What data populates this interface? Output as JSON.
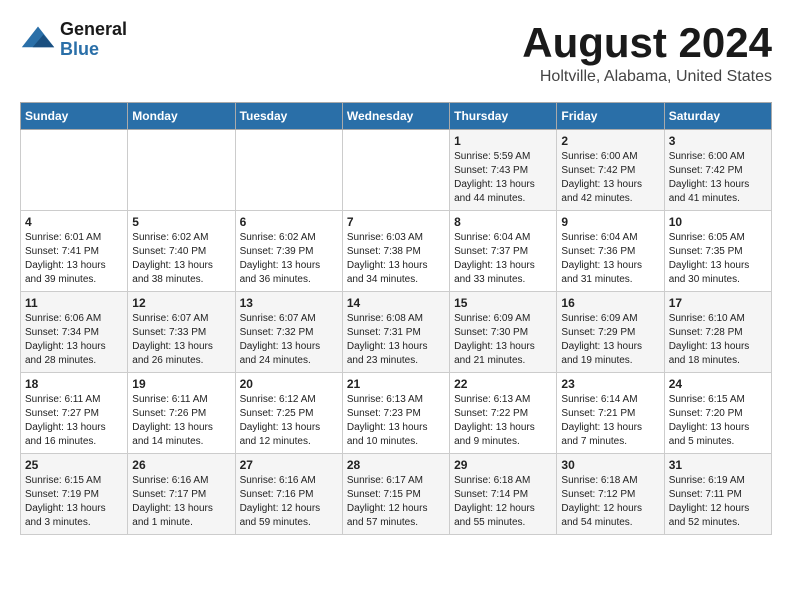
{
  "header": {
    "logo_line1": "General",
    "logo_line2": "Blue",
    "title": "August 2024",
    "subtitle": "Holtville, Alabama, United States"
  },
  "days_of_week": [
    "Sunday",
    "Monday",
    "Tuesday",
    "Wednesday",
    "Thursday",
    "Friday",
    "Saturday"
  ],
  "weeks": [
    [
      {
        "day": "",
        "info": ""
      },
      {
        "day": "",
        "info": ""
      },
      {
        "day": "",
        "info": ""
      },
      {
        "day": "",
        "info": ""
      },
      {
        "day": "1",
        "info": "Sunrise: 5:59 AM\nSunset: 7:43 PM\nDaylight: 13 hours\nand 44 minutes."
      },
      {
        "day": "2",
        "info": "Sunrise: 6:00 AM\nSunset: 7:42 PM\nDaylight: 13 hours\nand 42 minutes."
      },
      {
        "day": "3",
        "info": "Sunrise: 6:00 AM\nSunset: 7:42 PM\nDaylight: 13 hours\nand 41 minutes."
      }
    ],
    [
      {
        "day": "4",
        "info": "Sunrise: 6:01 AM\nSunset: 7:41 PM\nDaylight: 13 hours\nand 39 minutes."
      },
      {
        "day": "5",
        "info": "Sunrise: 6:02 AM\nSunset: 7:40 PM\nDaylight: 13 hours\nand 38 minutes."
      },
      {
        "day": "6",
        "info": "Sunrise: 6:02 AM\nSunset: 7:39 PM\nDaylight: 13 hours\nand 36 minutes."
      },
      {
        "day": "7",
        "info": "Sunrise: 6:03 AM\nSunset: 7:38 PM\nDaylight: 13 hours\nand 34 minutes."
      },
      {
        "day": "8",
        "info": "Sunrise: 6:04 AM\nSunset: 7:37 PM\nDaylight: 13 hours\nand 33 minutes."
      },
      {
        "day": "9",
        "info": "Sunrise: 6:04 AM\nSunset: 7:36 PM\nDaylight: 13 hours\nand 31 minutes."
      },
      {
        "day": "10",
        "info": "Sunrise: 6:05 AM\nSunset: 7:35 PM\nDaylight: 13 hours\nand 30 minutes."
      }
    ],
    [
      {
        "day": "11",
        "info": "Sunrise: 6:06 AM\nSunset: 7:34 PM\nDaylight: 13 hours\nand 28 minutes."
      },
      {
        "day": "12",
        "info": "Sunrise: 6:07 AM\nSunset: 7:33 PM\nDaylight: 13 hours\nand 26 minutes."
      },
      {
        "day": "13",
        "info": "Sunrise: 6:07 AM\nSunset: 7:32 PM\nDaylight: 13 hours\nand 24 minutes."
      },
      {
        "day": "14",
        "info": "Sunrise: 6:08 AM\nSunset: 7:31 PM\nDaylight: 13 hours\nand 23 minutes."
      },
      {
        "day": "15",
        "info": "Sunrise: 6:09 AM\nSunset: 7:30 PM\nDaylight: 13 hours\nand 21 minutes."
      },
      {
        "day": "16",
        "info": "Sunrise: 6:09 AM\nSunset: 7:29 PM\nDaylight: 13 hours\nand 19 minutes."
      },
      {
        "day": "17",
        "info": "Sunrise: 6:10 AM\nSunset: 7:28 PM\nDaylight: 13 hours\nand 18 minutes."
      }
    ],
    [
      {
        "day": "18",
        "info": "Sunrise: 6:11 AM\nSunset: 7:27 PM\nDaylight: 13 hours\nand 16 minutes."
      },
      {
        "day": "19",
        "info": "Sunrise: 6:11 AM\nSunset: 7:26 PM\nDaylight: 13 hours\nand 14 minutes."
      },
      {
        "day": "20",
        "info": "Sunrise: 6:12 AM\nSunset: 7:25 PM\nDaylight: 13 hours\nand 12 minutes."
      },
      {
        "day": "21",
        "info": "Sunrise: 6:13 AM\nSunset: 7:23 PM\nDaylight: 13 hours\nand 10 minutes."
      },
      {
        "day": "22",
        "info": "Sunrise: 6:13 AM\nSunset: 7:22 PM\nDaylight: 13 hours\nand 9 minutes."
      },
      {
        "day": "23",
        "info": "Sunrise: 6:14 AM\nSunset: 7:21 PM\nDaylight: 13 hours\nand 7 minutes."
      },
      {
        "day": "24",
        "info": "Sunrise: 6:15 AM\nSunset: 7:20 PM\nDaylight: 13 hours\nand 5 minutes."
      }
    ],
    [
      {
        "day": "25",
        "info": "Sunrise: 6:15 AM\nSunset: 7:19 PM\nDaylight: 13 hours\nand 3 minutes."
      },
      {
        "day": "26",
        "info": "Sunrise: 6:16 AM\nSunset: 7:17 PM\nDaylight: 13 hours\nand 1 minute."
      },
      {
        "day": "27",
        "info": "Sunrise: 6:16 AM\nSunset: 7:16 PM\nDaylight: 12 hours\nand 59 minutes."
      },
      {
        "day": "28",
        "info": "Sunrise: 6:17 AM\nSunset: 7:15 PM\nDaylight: 12 hours\nand 57 minutes."
      },
      {
        "day": "29",
        "info": "Sunrise: 6:18 AM\nSunset: 7:14 PM\nDaylight: 12 hours\nand 55 minutes."
      },
      {
        "day": "30",
        "info": "Sunrise: 6:18 AM\nSunset: 7:12 PM\nDaylight: 12 hours\nand 54 minutes."
      },
      {
        "day": "31",
        "info": "Sunrise: 6:19 AM\nSunset: 7:11 PM\nDaylight: 12 hours\nand 52 minutes."
      }
    ]
  ]
}
